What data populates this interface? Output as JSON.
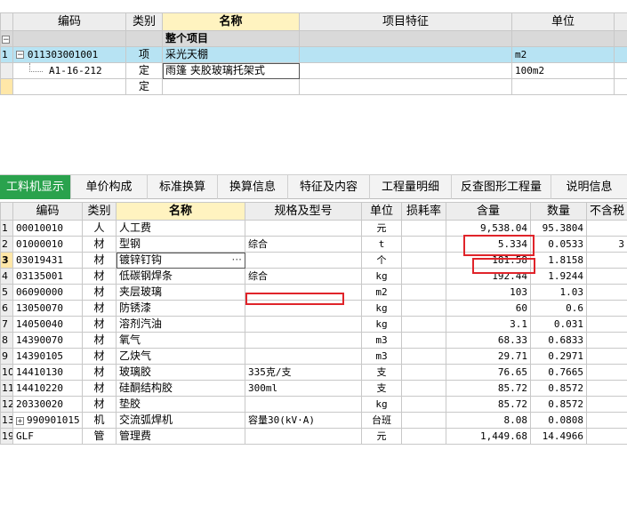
{
  "top_table": {
    "headers": [
      "编码",
      "类别",
      "名称",
      "项目特征",
      "单位"
    ],
    "rows": [
      {
        "rn": "",
        "code": "",
        "type": "",
        "name": "整个项目",
        "feature": "",
        "unit": "",
        "kind": "group",
        "toggle": "−"
      },
      {
        "rn": "1",
        "code": "011303001001",
        "type": "项",
        "name": "采光天棚",
        "feature": "",
        "unit": "m2",
        "kind": "sel",
        "toggle": "−"
      },
      {
        "rn": "",
        "code": "A1-16-212",
        "type": "定",
        "name": "雨篷 夹胶玻璃托架式",
        "feature": "",
        "unit": "100m2",
        "kind": "sub",
        "toggle": ""
      },
      {
        "rn": "",
        "code": "",
        "type": "定",
        "name": "",
        "feature": "",
        "unit": "",
        "kind": "empty",
        "toggle": ""
      }
    ]
  },
  "tabs": [
    {
      "label": "工料机显示",
      "active": true
    },
    {
      "label": "单价构成",
      "active": false
    },
    {
      "label": "标准换算",
      "active": false
    },
    {
      "label": "换算信息",
      "active": false
    },
    {
      "label": "特征及内容",
      "active": false
    },
    {
      "label": "工程量明细",
      "active": false
    },
    {
      "label": "反查图形工程量",
      "active": false
    },
    {
      "label": "说明信息",
      "active": false
    }
  ],
  "bottom_table": {
    "headers": [
      "编码",
      "类别",
      "名称",
      "规格及型号",
      "单位",
      "损耗率",
      "含量",
      "数量",
      "不含税"
    ],
    "rows": [
      {
        "rn": "1",
        "code": "00010010",
        "type": "人",
        "name": "人工费",
        "spec": "",
        "unit": "元",
        "loss": "",
        "content": "9,538.04",
        "qty": "95.3804",
        "extra": ""
      },
      {
        "rn": "2",
        "code": "01000010",
        "type": "材",
        "name": "型钢",
        "spec": "综合",
        "unit": "t",
        "loss": "",
        "content": "5.334",
        "qty": "0.0533",
        "extra": "3"
      },
      {
        "rn": "3",
        "code": "03019431",
        "type": "材",
        "name": "镀锌钉钩",
        "spec": "",
        "unit": "个",
        "loss": "",
        "content": "181.58",
        "qty": "1.8158",
        "extra": ""
      },
      {
        "rn": "4",
        "code": "03135001",
        "type": "材",
        "name": "低碳钢焊条",
        "spec": "综合",
        "unit": "kg",
        "loss": "",
        "content": "192.44",
        "qty": "1.9244",
        "extra": ""
      },
      {
        "rn": "5",
        "code": "06090000",
        "type": "材",
        "name": "夹层玻璃",
        "spec": "",
        "unit": "m2",
        "loss": "",
        "content": "103",
        "qty": "1.03",
        "extra": ""
      },
      {
        "rn": "6",
        "code": "13050070",
        "type": "材",
        "name": "防锈漆",
        "spec": "",
        "unit": "kg",
        "loss": "",
        "content": "60",
        "qty": "0.6",
        "extra": ""
      },
      {
        "rn": "7",
        "code": "14050040",
        "type": "材",
        "name": "溶剂汽油",
        "spec": "",
        "unit": "kg",
        "loss": "",
        "content": "3.1",
        "qty": "0.031",
        "extra": ""
      },
      {
        "rn": "8",
        "code": "14390070",
        "type": "材",
        "name": "氧气",
        "spec": "",
        "unit": "m3",
        "loss": "",
        "content": "68.33",
        "qty": "0.6833",
        "extra": ""
      },
      {
        "rn": "9",
        "code": "14390105",
        "type": "材",
        "name": "乙炔气",
        "spec": "",
        "unit": "m3",
        "loss": "",
        "content": "29.71",
        "qty": "0.2971",
        "extra": ""
      },
      {
        "rn": "10",
        "code": "14410130",
        "type": "材",
        "name": "玻璃胶",
        "spec": "335克/支",
        "unit": "支",
        "loss": "",
        "content": "76.65",
        "qty": "0.7665",
        "extra": ""
      },
      {
        "rn": "11",
        "code": "14410220",
        "type": "材",
        "name": "硅酮结构胶",
        "spec": "300ml",
        "unit": "支",
        "loss": "",
        "content": "85.72",
        "qty": "0.8572",
        "extra": ""
      },
      {
        "rn": "12",
        "code": "20330020",
        "type": "材",
        "name": "垫胶",
        "spec": "",
        "unit": "kg",
        "loss": "",
        "content": "85.72",
        "qty": "0.8572",
        "extra": ""
      },
      {
        "rn": "13",
        "code": "990901015",
        "type": "机",
        "name": "交流弧焊机",
        "spec": "容量30(kV·A)",
        "unit": "台班",
        "loss": "",
        "content": "8.08",
        "qty": "0.0808",
        "extra": "",
        "toggle": "+"
      },
      {
        "rn": "19",
        "code": "GLF",
        "type": "管",
        "name": "管理费",
        "spec": "",
        "unit": "元",
        "loss": "",
        "content": "1,449.68",
        "qty": "14.4966",
        "extra": ""
      }
    ]
  },
  "colors": {
    "tab_active": "#2aa24d",
    "selected_row": "#b7e3f3",
    "highlight_header": "#fff3c0",
    "annotation": "#e0242a"
  }
}
